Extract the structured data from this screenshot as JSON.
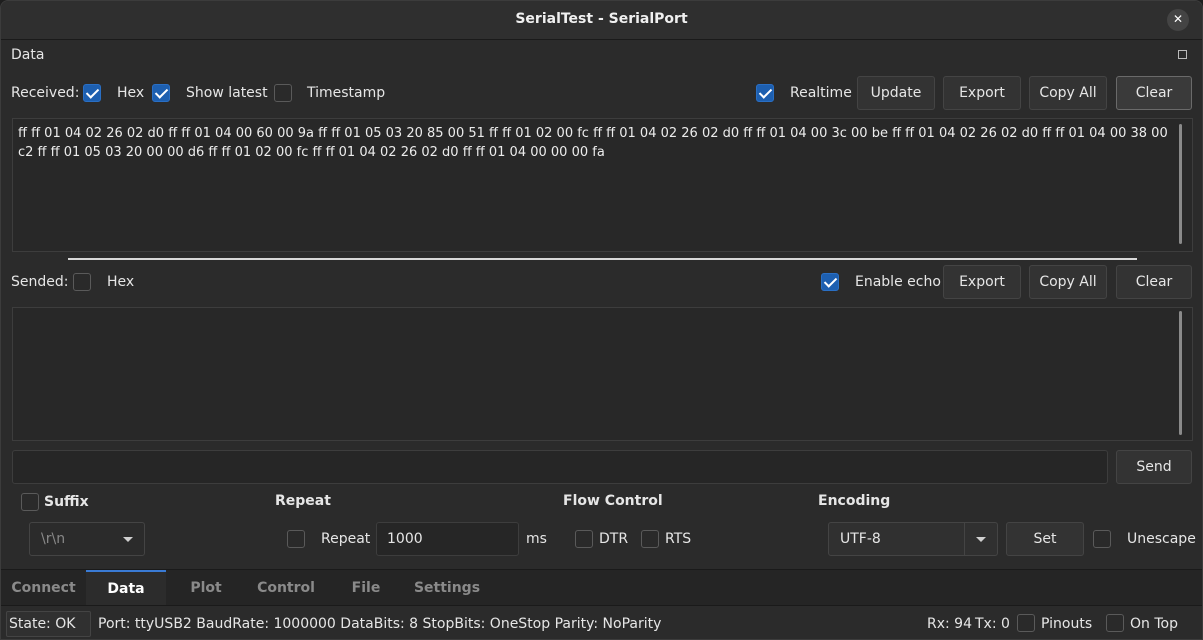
{
  "window": {
    "title": "SerialTest - SerialPort",
    "close_glyph": "✕"
  },
  "data_panel": {
    "label": "Data",
    "float_glyph": "▫"
  },
  "received": {
    "label": "Received:",
    "hex_label": "Hex",
    "hex_checked": true,
    "show_latest_label": "Show latest",
    "show_latest_checked": true,
    "timestamp_label": "Timestamp",
    "timestamp_checked": false,
    "realtime_label": "Realtime",
    "realtime_checked": true,
    "update_button": "Update",
    "export_button": "Export",
    "copy_all_button": "Copy All",
    "clear_button": "Clear",
    "content": "ff ff 01 04 02 26 02 d0 ff ff 01 04 00 60 00 9a ff ff 01 05 03 20 85 00 51 ff ff 01 02 00 fc ff ff 01 04 02 26 02 d0 ff ff 01 04 00 3c 00 be ff ff 01 04 02 26 02 d0 ff ff 01 04 00 38 00 c2 ff ff 01 05 03 20 00 00 d6 ff ff 01 02 00 fc ff ff 01 04 02 26 02 d0 ff ff 01 04 00 00 00 fa"
  },
  "sended": {
    "label": "Sended:",
    "hex_label": "Hex",
    "hex_checked": false,
    "enable_echo_label": "Enable echo",
    "enable_echo_checked": true,
    "export_button": "Export",
    "copy_all_button": "Copy All",
    "clear_button": "Clear",
    "content": ""
  },
  "send_row": {
    "input_value": "",
    "send_button": "Send"
  },
  "options": {
    "suffix_label": "Suffix",
    "suffix_checked": false,
    "suffix_value": "\\r\\n",
    "repeat_heading": "Repeat",
    "repeat_label": "Repeat",
    "repeat_checked": false,
    "repeat_value": "1000",
    "repeat_unit": "ms",
    "flow_heading": "Flow Control",
    "dtr_label": "DTR",
    "dtr_checked": false,
    "rts_label": "RTS",
    "rts_checked": false,
    "encoding_heading": "Encoding",
    "encoding_value": "UTF-8",
    "set_button": "Set",
    "unescape_label": "Unescape",
    "unescape_checked": false
  },
  "tabs": [
    {
      "label": "Connect",
      "active": false
    },
    {
      "label": "Data",
      "active": true
    },
    {
      "label": "Plot",
      "active": false
    },
    {
      "label": "Control",
      "active": false
    },
    {
      "label": "File",
      "active": false
    },
    {
      "label": "Settings",
      "active": false
    }
  ],
  "status": {
    "state": "State: OK",
    "port_info": "Port: ttyUSB2 BaudRate: 1000000 DataBits: 8 StopBits: OneStop Parity: NoParity",
    "rx": "Rx: 94",
    "tx": "Tx: 0",
    "pinouts_label": "Pinouts",
    "pinouts_checked": false,
    "on_top_label": "On Top",
    "on_top_checked": false
  },
  "colors": {
    "accent": "#1d5fb0",
    "tab_indicator": "#3a7bd5",
    "background": "#2b2b2b"
  }
}
